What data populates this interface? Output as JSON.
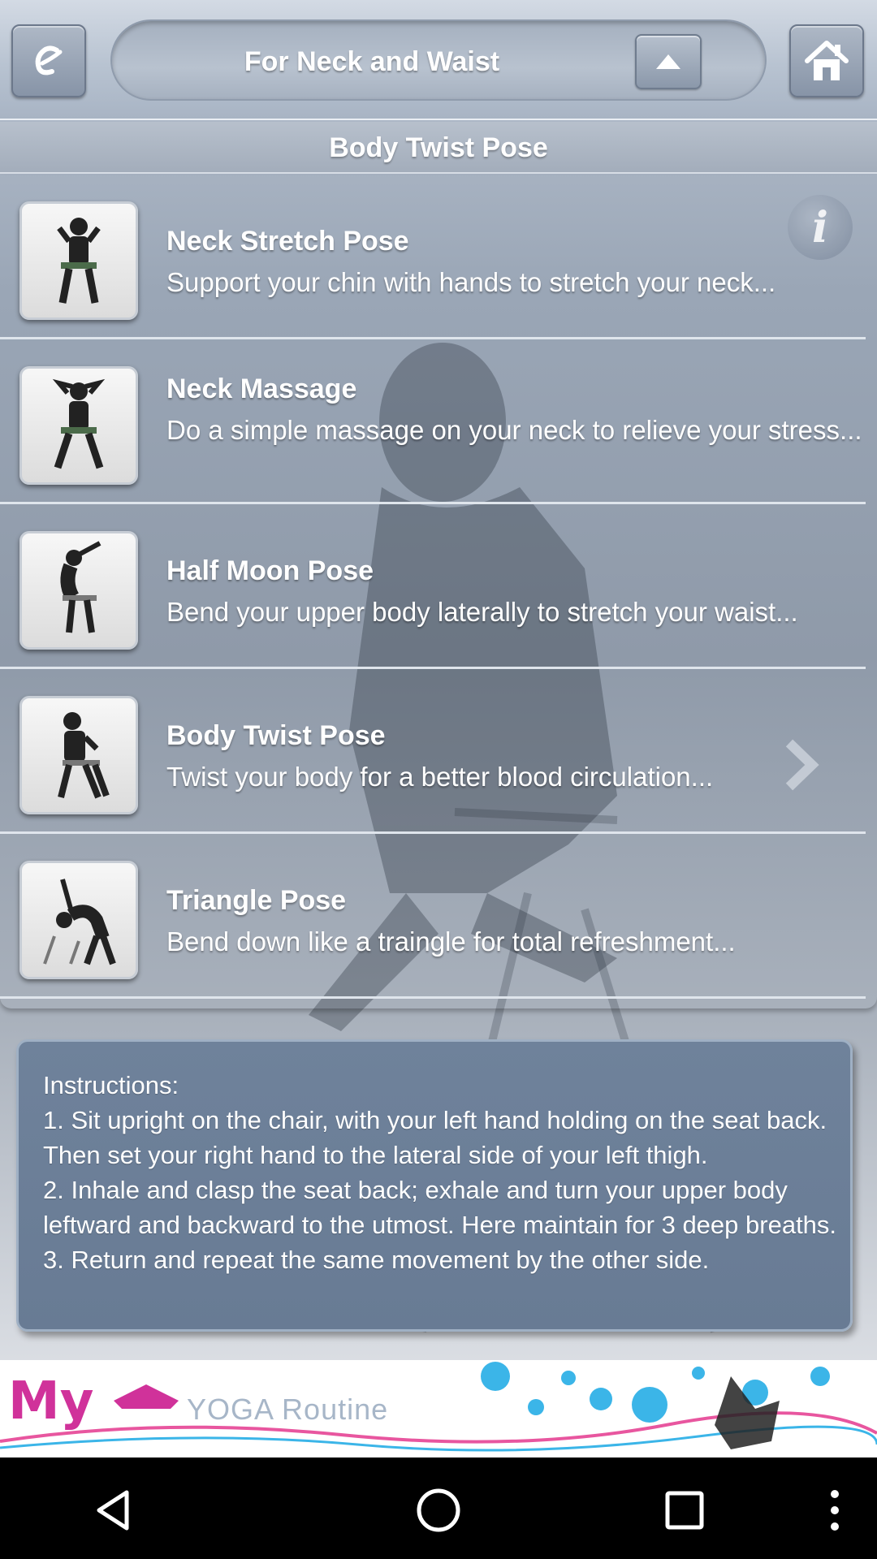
{
  "header": {
    "title": "For Neck and Waist",
    "app_icon": "app-logo-icon",
    "up_icon": "up-arrow-icon",
    "home_icon": "home-icon"
  },
  "section": {
    "title": "Body Twist Pose"
  },
  "list": {
    "items": [
      {
        "title": "Neck Stretch Pose",
        "description": "Support your chin with hands to stretch your neck..."
      },
      {
        "title": "Neck Massage",
        "description": "Do a simple massage on your neck to relieve your stress..."
      },
      {
        "title": "Half Moon Pose",
        "description": "Bend your upper body laterally to stretch your waist..."
      },
      {
        "title": "Body Twist Pose",
        "description": "Twist your body for a better blood circulation..."
      },
      {
        "title": "Triangle Pose",
        "description": "Bend down like a traingle for total refreshment..."
      }
    ]
  },
  "instructions": {
    "text": "Instructions:\n1. Sit upright on the chair, with your left hand holding on the seat back. Then set your right hand to the lateral side of your left thigh.\n2. Inhale and clasp the seat back; exhale and turn your upper body leftward and backward to the utmost. Here maintain for 3 deep breaths.\n3. Return and repeat the same movement by the other side."
  },
  "banner": {
    "brand": "My",
    "subtitle": "YOGA Routine"
  },
  "colors": {
    "accent": "#d0329a",
    "panel": "#6f829b"
  }
}
